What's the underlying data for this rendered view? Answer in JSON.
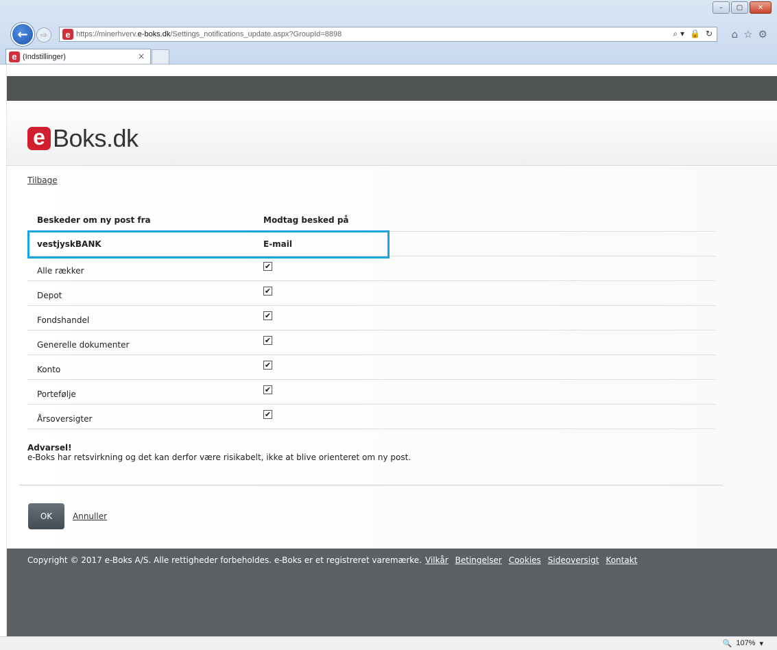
{
  "browser": {
    "url_prefix": "https://minerhverv.",
    "url_domain": "e-boks.dk",
    "url_path": "/Settings_notifications_update.aspx?GroupId=8898",
    "tab_title": "(Indstillinger)",
    "tab_close": "×",
    "site_icon": "e",
    "window_buttons": [
      "–",
      "▢",
      "✕"
    ],
    "address_tools": [
      "⌕ ▾",
      "🔒",
      "↻"
    ],
    "nav_icons": [
      "⌂",
      "☆",
      "⚙"
    ],
    "zoom_level": "107%",
    "zoom_dropdown": "▾",
    "zoom_icon": "🔍"
  },
  "logo": {
    "mark": "e",
    "text": "Boks.dk"
  },
  "page": {
    "back_link": "Tilbage",
    "table": {
      "col1_header": "Beskeder om ny post fra",
      "col2_header": "Modtag besked på",
      "group_name": "vestjyskBANK",
      "group_channel": "E-mail",
      "items": [
        {
          "label": "Alle rækker",
          "checked": true
        },
        {
          "label": "Depot",
          "checked": true
        },
        {
          "label": "Fondshandel",
          "checked": true
        },
        {
          "label": "Generelle dokumenter",
          "checked": true
        },
        {
          "label": "Konto",
          "checked": true
        },
        {
          "label": "Portefølje",
          "checked": true
        },
        {
          "label": "Årsoversigter",
          "checked": true
        }
      ]
    },
    "warning_title": "Advarsel!",
    "warning_text": "e-Boks har retsvirkning og det kan derfor være risikabelt, ikke at blive orienteret om ny post.",
    "ok_label": "OK",
    "cancel_label": "Annuller"
  },
  "footer": {
    "copyright": "Copyright © 2017 e-Boks A/S. Alle rettigheder forbeholdes. e-Boks er et registreret varemærke.",
    "links": [
      "Vilkår",
      "Betingelser",
      "Cookies",
      "Sideoversigt",
      "Kontakt"
    ]
  },
  "colors": {
    "highlight": "#1aa5e0",
    "brand": "#d01e2f",
    "footer": "#5b6064"
  }
}
